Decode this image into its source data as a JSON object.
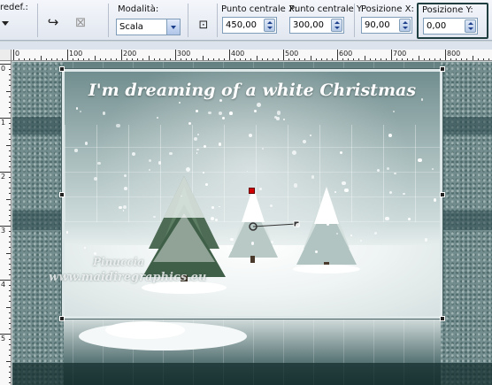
{
  "toolbar": {
    "preset_label": "redef.:",
    "mode_label": "Modalità:",
    "mode_value": "Scala",
    "center_x_label": "Punto centrale X:",
    "center_x_value": "450,00",
    "center_y_label": "Punto centrale Y:",
    "center_y_value": "300,00",
    "pos_x_label": "Posizione X:",
    "pos_x_value": "90,00",
    "pos_y_label": "Posizione Y:",
    "pos_y_value": "0,00"
  },
  "ruler": {
    "h_numbers": [
      "0",
      "100",
      "200",
      "300",
      "400",
      "500",
      "600",
      "700",
      "800"
    ],
    "v_numbers": [
      "0",
      "1",
      "2",
      "3",
      "4",
      "5"
    ]
  },
  "canvas": {
    "title": "I'm dreaming of a white Christmas",
    "watermark_name": "Pinuccia",
    "watermark_url": "www.maidiregraphics.eu"
  }
}
